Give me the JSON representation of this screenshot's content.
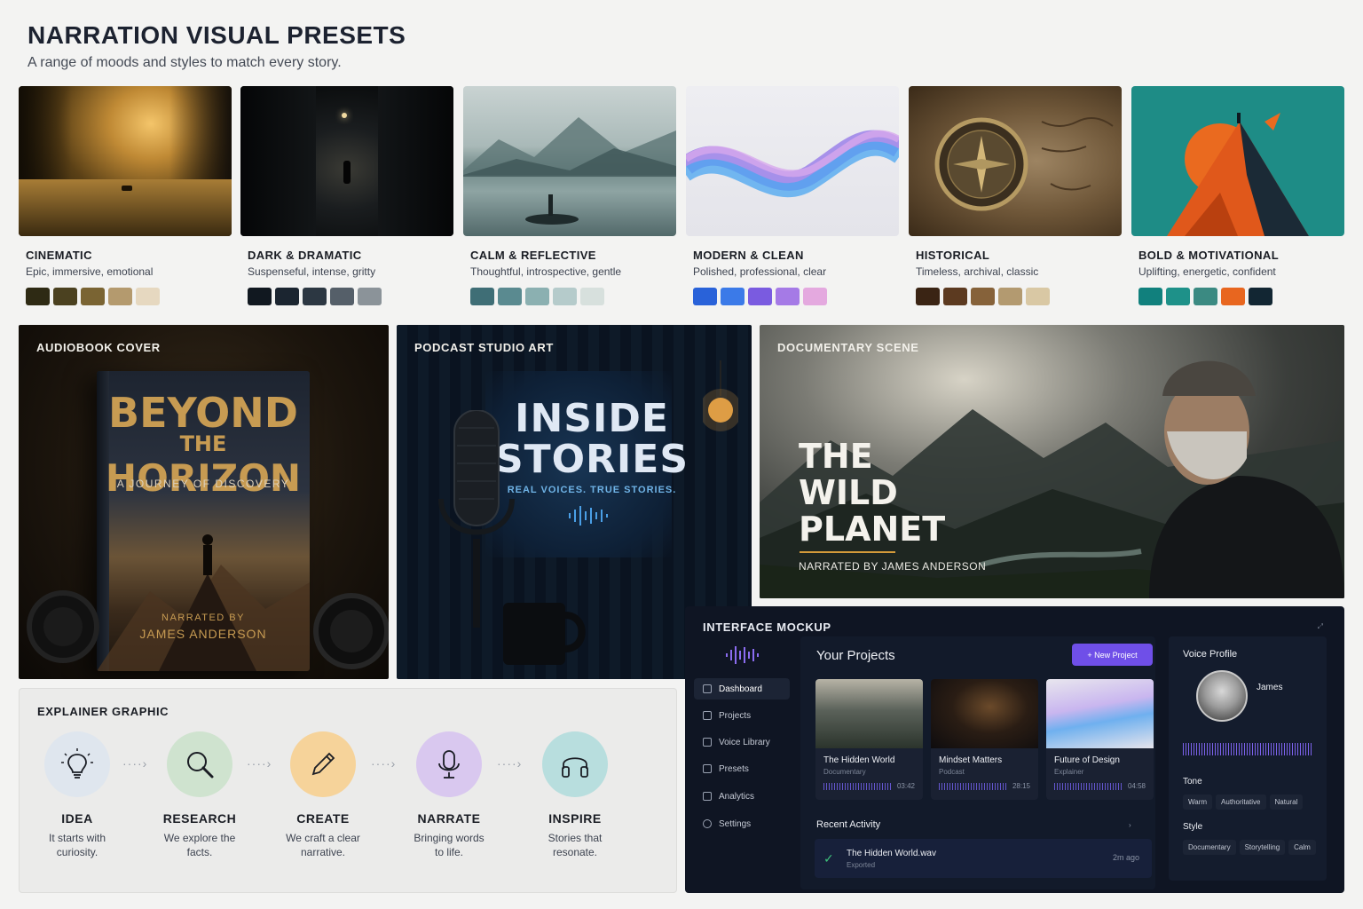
{
  "header": {
    "title": "NARRATION VISUAL PRESETS",
    "subtitle": "A range of moods and styles to match every story."
  },
  "presets": [
    {
      "name": "CINEMATIC",
      "desc": "Epic, immersive, emotional",
      "swatches": [
        "#2e2a14",
        "#4b4120",
        "#7a6433",
        "#b49a6e",
        "#e6d8c0"
      ]
    },
    {
      "name": "DARK & DRAMATIC",
      "desc": "Suspenseful, intense, gritty",
      "swatches": [
        "#111820",
        "#1b2530",
        "#2c3742",
        "#555f69",
        "#8b9399"
      ]
    },
    {
      "name": "CALM & REFLECTIVE",
      "desc": "Thoughtful, introspective, gentle",
      "swatches": [
        "#3f6e76",
        "#5a8a90",
        "#8bb0b1",
        "#b5cbcb",
        "#d7e0dd"
      ]
    },
    {
      "name": "MODERN & CLEAN",
      "desc": "Polished, professional, clear",
      "swatches": [
        "#2962d9",
        "#3b7ae8",
        "#7a5be0",
        "#a57ae6",
        "#e4a9df"
      ]
    },
    {
      "name": "HISTORICAL",
      "desc": "Timeless, archival, classic",
      "swatches": [
        "#3a2414",
        "#5c3a20",
        "#86623a",
        "#b39a70",
        "#d9c8a4"
      ]
    },
    {
      "name": "BOLD & MOTIVATIONAL",
      "desc": "Uplifting, energetic, confident",
      "swatches": [
        "#11807d",
        "#1e9189",
        "#3b8a82",
        "#e8661f",
        "#122633"
      ]
    }
  ],
  "audiobook": {
    "label": "AUDIOBOOK COVER",
    "title_line1": "BEYOND",
    "title_line2a": "THE",
    "title_line2b": "HORIZON",
    "tagline": "A JOURNEY OF DISCOVERY",
    "narrated_by": "NARRATED BY",
    "narrator": "JAMES ANDERSON"
  },
  "podcast": {
    "label": "PODCAST STUDIO ART",
    "title_line1": "INSIDE",
    "title_line2": "STORIES",
    "tagline": "REAL VOICES. TRUE STORIES."
  },
  "documentary": {
    "label": "DOCUMENTARY SCENE",
    "title_line1": "THE",
    "title_line2": "WILD",
    "title_line3": "PLANET",
    "narrated": "NARRATED BY JAMES ANDERSON"
  },
  "explainer": {
    "label": "EXPLAINER GRAPHIC",
    "steps": [
      {
        "title": "IDEA",
        "text1": "It starts with",
        "text2": "curiosity.",
        "color": "#dfe6ee",
        "icon": "lightbulb-icon"
      },
      {
        "title": "RESEARCH",
        "text1": "We explore the",
        "text2": "facts.",
        "color": "#cfe3cf",
        "icon": "magnifier-icon"
      },
      {
        "title": "CREATE",
        "text1": "We craft a clear",
        "text2": "narrative.",
        "color": "#f6d39a",
        "icon": "pencil-icon"
      },
      {
        "title": "NARRATE",
        "text1": "Bringing words",
        "text2": "to life.",
        "color": "#d9c8ef",
        "icon": "microphone-icon"
      },
      {
        "title": "INSPIRE",
        "text1": "Stories that",
        "text2": "resonate.",
        "color": "#b8dede",
        "icon": "headphones-icon"
      }
    ]
  },
  "mockup": {
    "label": "INTERFACE MOCKUP",
    "nav": [
      "Dashboard",
      "Projects",
      "Voice Library",
      "Presets",
      "Analytics",
      "Settings"
    ],
    "projects_title": "Your Projects",
    "new_project": "+ New Project",
    "projects": [
      {
        "title": "The Hidden World",
        "type": "Documentary",
        "duration": "03:42"
      },
      {
        "title": "Mindset Matters",
        "type": "Podcast",
        "duration": "28:15"
      },
      {
        "title": "Future of Design",
        "type": "Explainer",
        "duration": "04:58"
      }
    ],
    "recent_title": "Recent Activity",
    "recent_item": "The Hidden World.wav",
    "recent_status": "Exported",
    "recent_time": "2m ago",
    "voice_profile": "Voice Profile",
    "voice_name": "James",
    "tone_label": "Tone",
    "tones": [
      "Warm",
      "Authoritative",
      "Natural"
    ],
    "style_label": "Style",
    "styles": [
      "Documentary",
      "Storytelling",
      "Calm"
    ]
  }
}
